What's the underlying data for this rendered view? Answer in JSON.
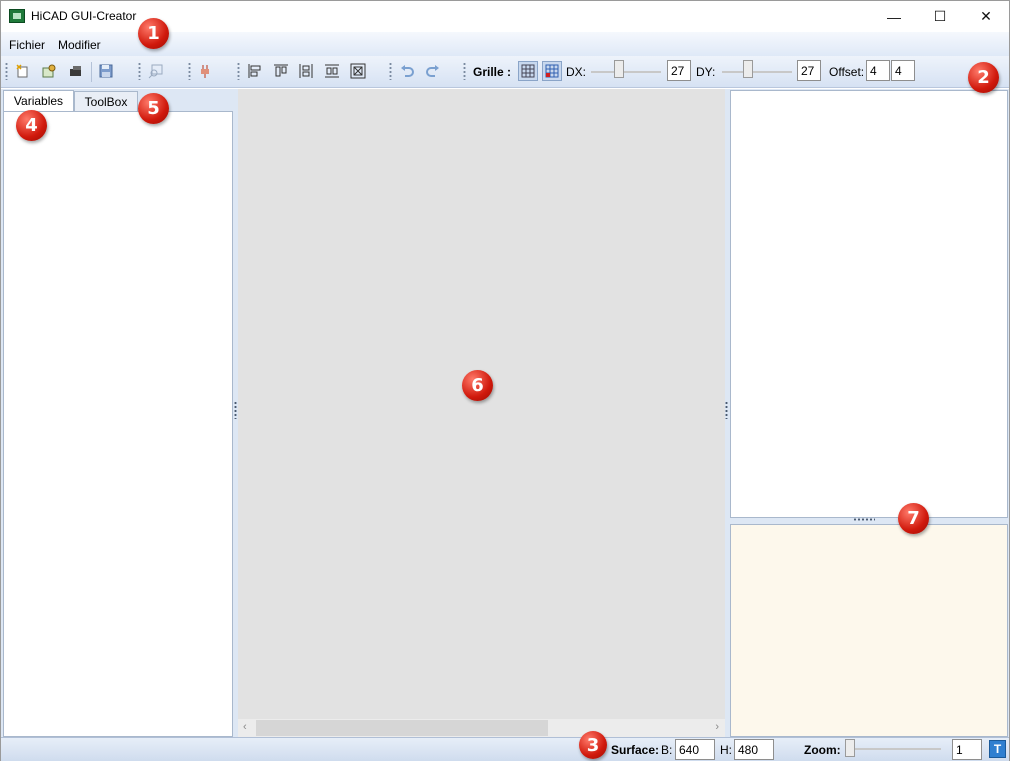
{
  "window": {
    "title": "HiCAD GUI-Creator",
    "minimize_glyph": "—",
    "maximize_glyph": "☐",
    "close_glyph": "✕"
  },
  "menubar": {
    "items": [
      {
        "label": "Fichier"
      },
      {
        "label": "Modifier"
      }
    ]
  },
  "toolbar": {
    "icons": [
      {
        "name": "new-icon"
      },
      {
        "name": "open-icon"
      },
      {
        "name": "import-icon"
      },
      {
        "name": "save-icon"
      },
      {
        "name": "preview-icon"
      },
      {
        "name": "plugin-icon"
      },
      {
        "name": "align-left-icon"
      },
      {
        "name": "align-top-icon"
      },
      {
        "name": "distribute-horizontal-icon"
      },
      {
        "name": "distribute-vertical-icon"
      },
      {
        "name": "center-icon"
      },
      {
        "name": "undo-icon"
      },
      {
        "name": "redo-icon"
      },
      {
        "name": "grid-icon"
      },
      {
        "name": "snap-grid-icon"
      }
    ],
    "grille_label": "Grille :",
    "dx_label": "DX:",
    "dx_value": "27",
    "dy_label": "DY:",
    "dy_value": "27",
    "offset_label": "Offset:",
    "offset_x": "4",
    "offset_y": "4"
  },
  "left_panel": {
    "tabs": [
      {
        "label": "Variables",
        "active": true
      },
      {
        "label": "ToolBox",
        "active": false
      }
    ]
  },
  "statusbar": {
    "surface_label": "Surface:",
    "b_label": "B:",
    "b_value": "640",
    "h_label": "H:",
    "h_value": "480",
    "zoom_label": "Zoom:",
    "zoom_value": "1",
    "text_button": "T"
  },
  "callouts": [
    "1",
    "2",
    "3",
    "4",
    "5",
    "6",
    "7"
  ],
  "colors": {
    "accent": "#2f7fd0",
    "callout_red": "#d0190c",
    "canvas": "#e2e2e2",
    "properties_bg": "#fdf8ec"
  }
}
